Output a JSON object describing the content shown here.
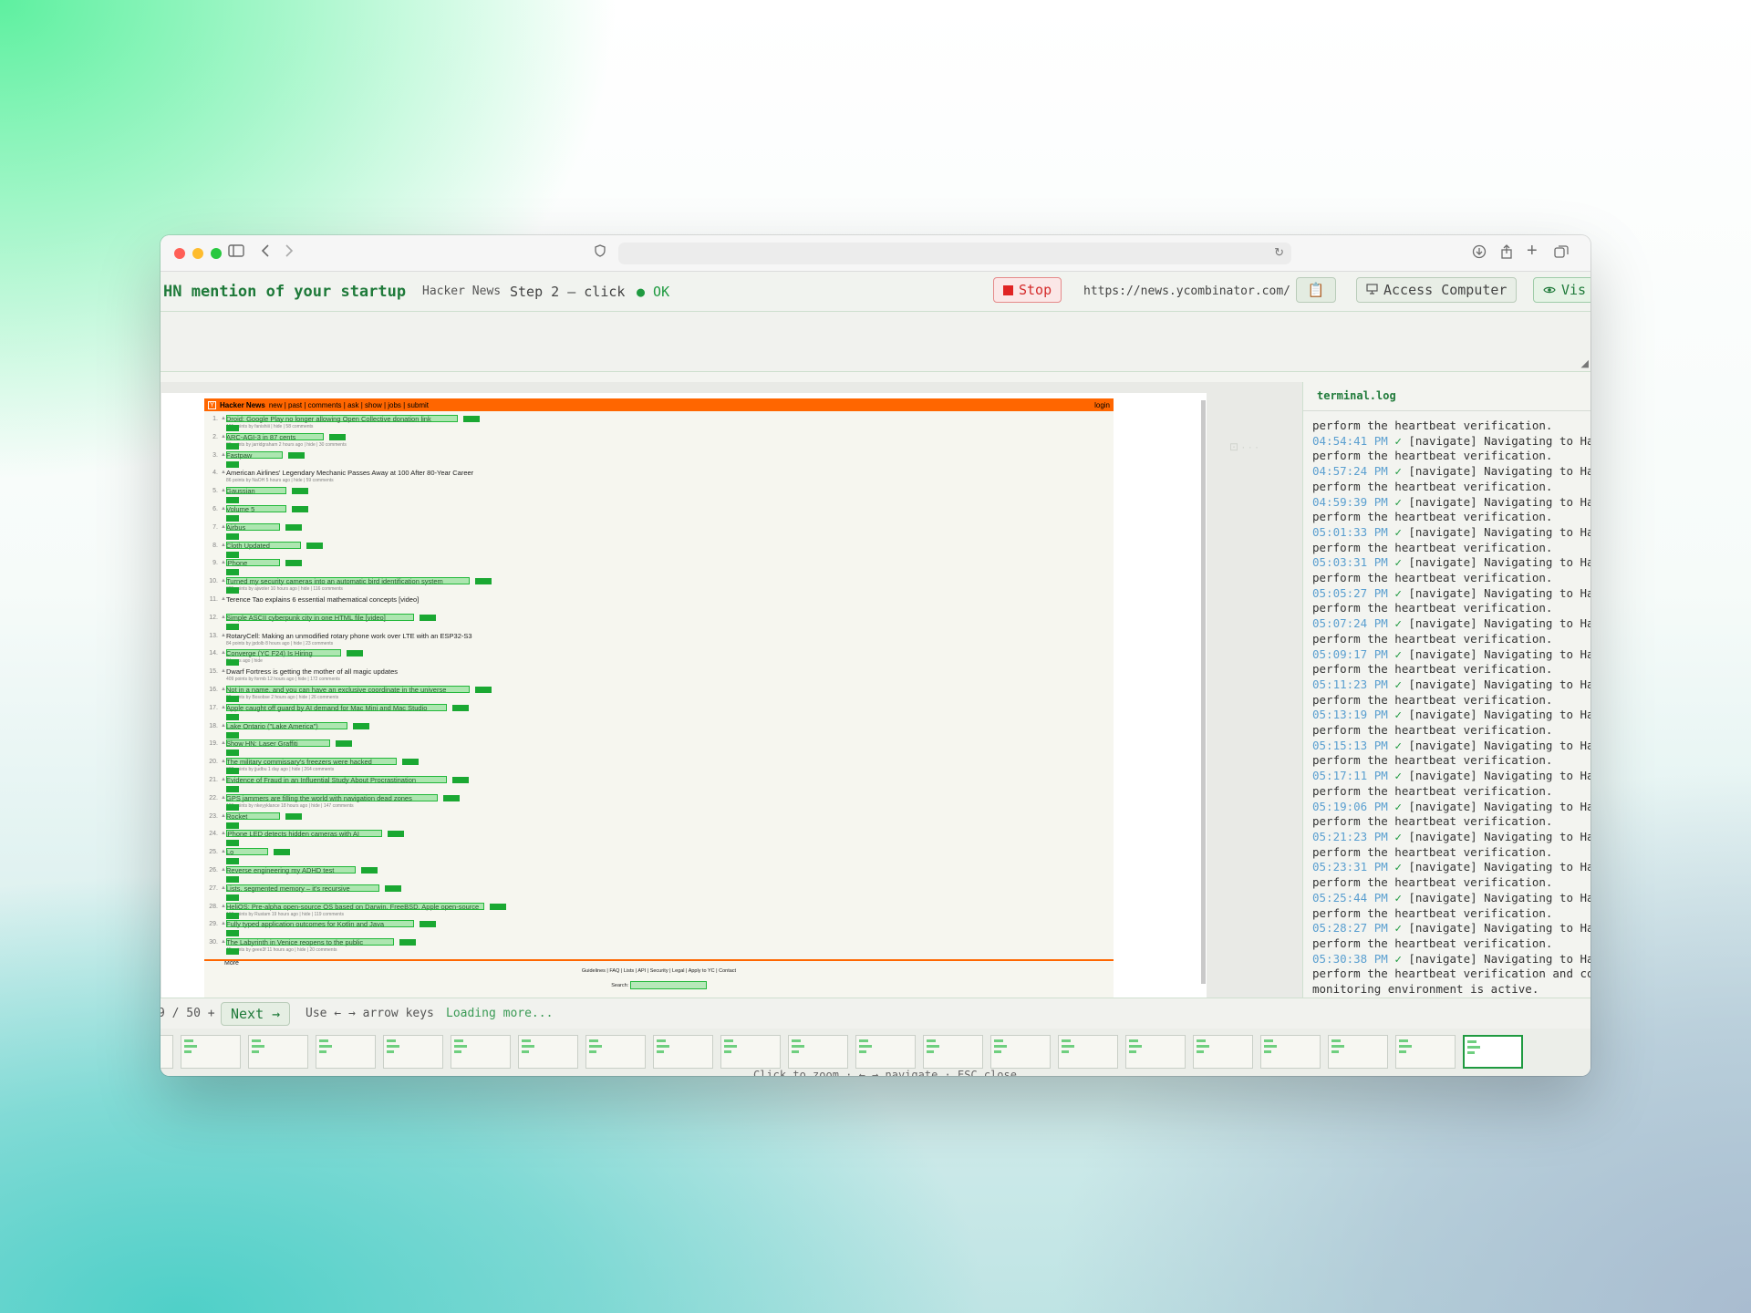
{
  "browser": {
    "traffic_lights": [
      "close",
      "minimize",
      "zoom"
    ],
    "icons": [
      "sidebar-icon",
      "back-icon",
      "forward-icon",
      "shield-icon",
      "reload-icon",
      "download-icon",
      "share-icon",
      "new-tab-icon",
      "tabs-icon"
    ]
  },
  "toolbar": {
    "title": "HN mention of your startup",
    "site": "Hacker News",
    "step": "Step 2 — click",
    "status": "● OK",
    "stop_label": "Stop",
    "url": "https://news.ycombinator.com/",
    "clipboard_icon": "📋",
    "access_label": "Access Computer",
    "vis_label": "Vis"
  },
  "hn": {
    "nav_brand": "Hacker News",
    "nav_links": "new | past | comments | ask | show | jobs | submit",
    "login": "login",
    "stories": [
      {
        "rank": "1.",
        "title": "Droid: Google Play no longer allowing Open Collective donation link",
        "sub": "191 points by fanishiii | hide | 58 comments",
        "hl": 1
      },
      {
        "rank": "2.",
        "title": "ARC-AGI-3 in 87 cents",
        "sub": "83 points by jarridgraham 2 hours ago | hide | 30 comments",
        "hl": 1
      },
      {
        "rank": "3.",
        "title": "Fastpaw",
        "sub": "",
        "hl": 1
      },
      {
        "rank": "4.",
        "title": "American Airlines' Legendary Mechanic Passes Away at 100 After 80-Year Career",
        "sub": "86 points by NaOH 5 hours ago | hide | 59 comments",
        "hl": 0
      },
      {
        "rank": "5.",
        "title": "Gaussian",
        "sub": "",
        "hl": 1
      },
      {
        "rank": "6.",
        "title": "Volume 5",
        "sub": "",
        "hl": 1
      },
      {
        "rank": "7.",
        "title": "Airbus",
        "sub": "",
        "hl": 1
      },
      {
        "rank": "8.",
        "title": "Cloth Updated",
        "sub": "",
        "hl": 1
      },
      {
        "rank": "9.",
        "title": "iPhone",
        "sub": "",
        "hl": 1
      },
      {
        "rank": "10.",
        "title": "Turned my security cameras into an automatic bird identification system",
        "sub": "325 points by ajwoter 10 hours ago | hide | 116 comments",
        "hl": 1
      },
      {
        "rank": "11.",
        "title": "Terence Tao explains 6 essential mathematical concepts [video]",
        "sub": "",
        "hl": 0
      },
      {
        "rank": "12.",
        "title": "Simple ASCII cyberpunk city in one HTML file [video]",
        "sub": "",
        "hl": 1
      },
      {
        "rank": "13.",
        "title": "RotaryCell: Making an unmodified rotary phone work over LTE with an ESP32-S3",
        "sub": "84 points by jpdolb 8 hours ago | hide | 23 comments",
        "hl": 0
      },
      {
        "rank": "14.",
        "title": "Converge (YC F24) Is Hiring",
        "sub": "6 hours ago | hide",
        "hl": 1
      },
      {
        "rank": "15.",
        "title": "Dwarf Fortress is getting the mother of all magic updates",
        "sub": "409 points by formb 12 hours ago | hide | 172 comments",
        "hl": 0
      },
      {
        "rank": "16.",
        "title": "Not in a name, and you can have an exclusive coordinate in the universe",
        "sub": "26 points by Bosobse 2 hours ago | hide | 26 comments",
        "hl": 1
      },
      {
        "rank": "17.",
        "title": "Apple caught off guard by AI demand for Mac Mini and Mac Studio",
        "sub": "",
        "hl": 1
      },
      {
        "rank": "18.",
        "title": "Lake Ontario (\"Lake America\")",
        "sub": "",
        "hl": 1
      },
      {
        "rank": "19.",
        "title": "Show HN: Laser Graffiti",
        "sub": "",
        "hl": 1
      },
      {
        "rank": "20.",
        "title": "The military commissary's freezers were hacked",
        "sub": "388 points by jjudbu 1 day ago | hide | 264 comments",
        "hl": 1
      },
      {
        "rank": "21.",
        "title": "Evidence of Fraud in an Influential Study About Procrastination",
        "sub": "",
        "hl": 1
      },
      {
        "rank": "22.",
        "title": "GPS jammers are filling the world with navigation dead zones",
        "sub": "186 points by nkeyyklance 18 hours ago | hide | 147 comments",
        "hl": 1
      },
      {
        "rank": "23.",
        "title": "Rocket",
        "sub": "",
        "hl": 1
      },
      {
        "rank": "24.",
        "title": "iPhone LED detects hidden cameras with AI",
        "sub": "",
        "hl": 1
      },
      {
        "rank": "25.",
        "title": "Lo",
        "sub": "",
        "hl": 1
      },
      {
        "rank": "26.",
        "title": "Reverse engineering my ADHD test",
        "sub": "",
        "hl": 1
      },
      {
        "rank": "27.",
        "title": "Lists, segmented memory – it's recursive",
        "sub": "",
        "hl": 1
      },
      {
        "rank": "28.",
        "title": "HeliOS: Pre-alpha open-source OS based on Darwin, FreeBSD, Apple open-source",
        "sub": "169 points by Rustam 19 hours ago | hide | 119 comments",
        "hl": 1
      },
      {
        "rank": "29.",
        "title": "Fully typed application outcomes for Kotlin and Java",
        "sub": "",
        "hl": 1
      },
      {
        "rank": "30.",
        "title": "The Labyrinth in Venice reopens to the public",
        "sub": "45 points by geee3f 11 hours ago | hide | 20 comments",
        "hl": 1
      }
    ],
    "more": "More",
    "footer_links": "Guidelines | FAQ | Lists | API | Security | Legal | Apply to YC | Contact",
    "search_label": "Search:"
  },
  "terminal": {
    "title": "terminal.log",
    "entries": [
      {
        "time": "",
        "text": "perform the heartbeat verification."
      },
      {
        "time": "04:54:41 PM",
        "text": "[navigate] Navigating to Hac"
      },
      {
        "time": "",
        "text": "perform the heartbeat verification."
      },
      {
        "time": "04:57:24 PM",
        "text": "[navigate] Navigating to Hac"
      },
      {
        "time": "",
        "text": "perform the heartbeat verification."
      },
      {
        "time": "04:59:39 PM",
        "text": "[navigate] Navigating to Hac"
      },
      {
        "time": "",
        "text": "perform the heartbeat verification."
      },
      {
        "time": "05:01:33 PM",
        "text": "[navigate] Navigating to Hac"
      },
      {
        "time": "",
        "text": "perform the heartbeat verification."
      },
      {
        "time": "05:03:31 PM",
        "text": "[navigate] Navigating to Hac"
      },
      {
        "time": "",
        "text": "perform the heartbeat verification."
      },
      {
        "time": "05:05:27 PM",
        "text": "[navigate] Navigating to Hac"
      },
      {
        "time": "",
        "text": "perform the heartbeat verification."
      },
      {
        "time": "05:07:24 PM",
        "text": "[navigate] Navigating to Hac"
      },
      {
        "time": "",
        "text": "perform the heartbeat verification."
      },
      {
        "time": "05:09:17 PM",
        "text": "[navigate] Navigating to Hac"
      },
      {
        "time": "",
        "text": "perform the heartbeat verification."
      },
      {
        "time": "05:11:23 PM",
        "text": "[navigate] Navigating to Hac"
      },
      {
        "time": "",
        "text": "perform the heartbeat verification."
      },
      {
        "time": "05:13:19 PM",
        "text": "[navigate] Navigating to Hac"
      },
      {
        "time": "",
        "text": "perform the heartbeat verification."
      },
      {
        "time": "05:15:13 PM",
        "text": "[navigate] Navigating to Hac"
      },
      {
        "time": "",
        "text": "perform the heartbeat verification."
      },
      {
        "time": "05:17:11 PM",
        "text": "[navigate] Navigating to Hac"
      },
      {
        "time": "",
        "text": "perform the heartbeat verification."
      },
      {
        "time": "05:19:06 PM",
        "text": "[navigate] Navigating to Hac"
      },
      {
        "time": "",
        "text": "perform the heartbeat verification."
      },
      {
        "time": "05:21:23 PM",
        "text": "[navigate] Navigating to Hac"
      },
      {
        "time": "",
        "text": "perform the heartbeat verification."
      },
      {
        "time": "05:23:31 PM",
        "text": "[navigate] Navigating to Hac"
      },
      {
        "time": "",
        "text": "perform the heartbeat verification."
      },
      {
        "time": "05:25:44 PM",
        "text": "[navigate] Navigating to Hac"
      },
      {
        "time": "",
        "text": "perform the heartbeat verification."
      },
      {
        "time": "05:28:27 PM",
        "text": "[navigate] Navigating to Hac"
      },
      {
        "time": "",
        "text": "perform the heartbeat verification."
      },
      {
        "time": "05:30:38 PM",
        "text": "[navigate] Navigating to Hac"
      },
      {
        "time": "",
        "text": "perform the heartbeat verification and co"
      },
      {
        "time": "",
        "text": "monitoring environment is active."
      }
    ]
  },
  "bottom": {
    "counter": "9 / 50 +",
    "next_label": "Next →",
    "hint": "Use ← → arrow keys",
    "loading": "Loading more..."
  },
  "thumbnails": {
    "count": 21,
    "active_index": 20,
    "caption": "Click to zoom · ← → navigate · ESC close"
  },
  "colors": {
    "accent": "#1f7a3a",
    "hn_orange": "#ff6600",
    "highlight": "#26c83c",
    "stop_red": "#e02424",
    "timestamp_blue": "#5a9fd0"
  }
}
